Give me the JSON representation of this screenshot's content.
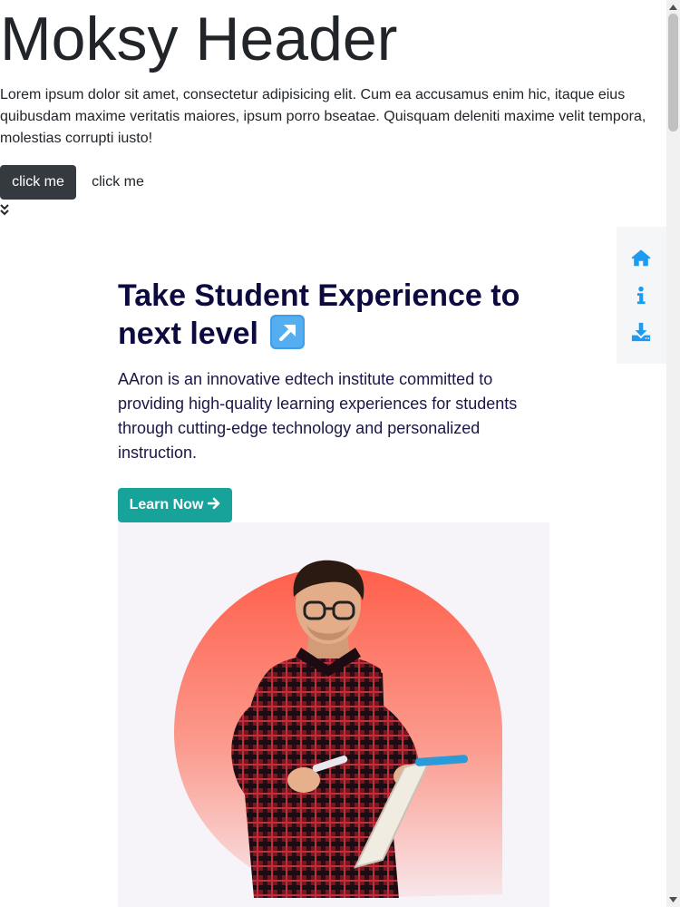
{
  "header": {
    "title": "Moksy Header",
    "intro": "Lorem ipsum dolor sit amet, consectetur adipisicing elit. Cum ea accusamus enim hic, itaque eius quibusdam maxime veritatis maiores, ipsum porro bseatae. Quisquam deleniti maxime velit tempora, molestias corrupti iusto!",
    "button_primary": "click me",
    "button_link": "click me"
  },
  "side_nav": {
    "items": [
      {
        "icon": "home-icon"
      },
      {
        "icon": "info-icon"
      },
      {
        "icon": "download-icon"
      }
    ],
    "color": "#1e9bf0"
  },
  "hero": {
    "title": "Take Student Experience to next level",
    "title_emoji": "arrow-up-right-icon",
    "description": "AAron is an innovative edtech institute committed to providing high-quality learning experiences for students through cutting-edge technology and personalized instruction.",
    "cta_label": "Learn Now",
    "cta_color": "#18a39a",
    "title_color": "#0c0a3e"
  }
}
